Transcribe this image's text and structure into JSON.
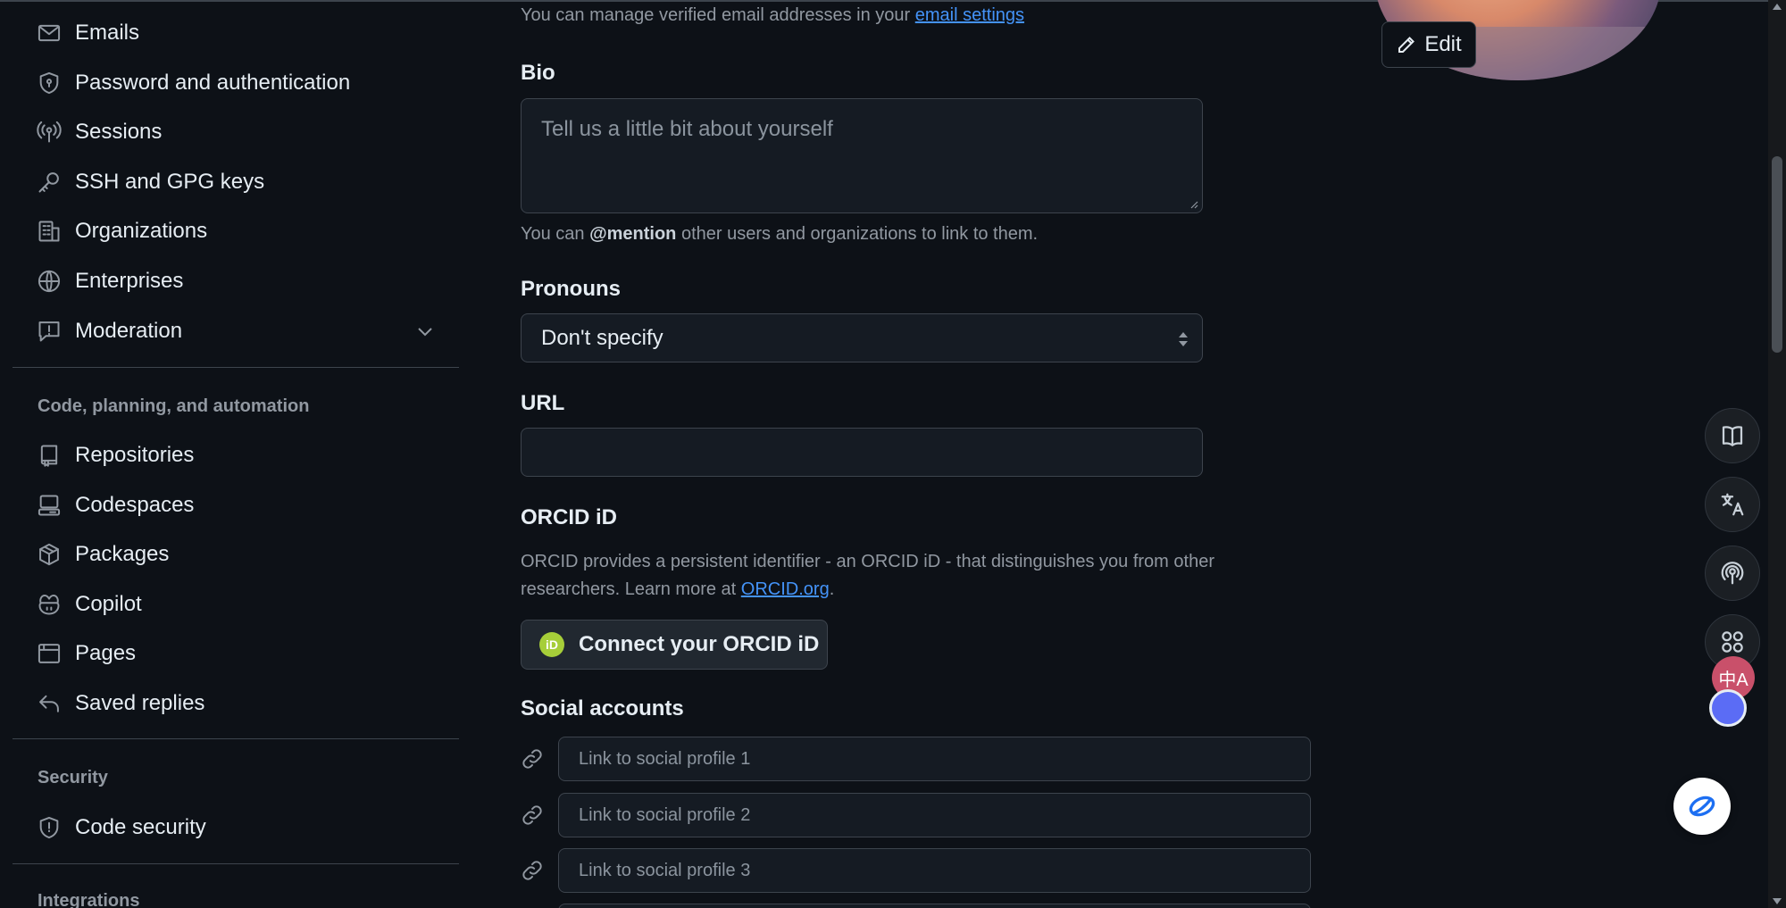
{
  "sidebar": {
    "items_top": [
      {
        "label": "Emails",
        "icon": "mail-icon"
      },
      {
        "label": "Password and authentication",
        "icon": "shield-lock-icon"
      },
      {
        "label": "Sessions",
        "icon": "broadcast-icon"
      },
      {
        "label": "SSH and GPG keys",
        "icon": "key-icon"
      },
      {
        "label": "Organizations",
        "icon": "organization-icon"
      },
      {
        "label": "Enterprises",
        "icon": "globe-icon"
      },
      {
        "label": "Moderation",
        "icon": "report-icon"
      }
    ],
    "section_code": "Code, planning, and automation",
    "items_code": [
      {
        "label": "Repositories",
        "icon": "repo-icon"
      },
      {
        "label": "Codespaces",
        "icon": "codespaces-icon"
      },
      {
        "label": "Packages",
        "icon": "package-icon"
      },
      {
        "label": "Copilot",
        "icon": "copilot-icon"
      },
      {
        "label": "Pages",
        "icon": "browser-icon"
      },
      {
        "label": "Saved replies",
        "icon": "reply-icon"
      }
    ],
    "section_security": "Security",
    "items_security": [
      {
        "label": "Code security",
        "icon": "shield-icon"
      }
    ],
    "section_integrations": "Integrations"
  },
  "main": {
    "email_note_prefix": "You can manage verified email addresses in your",
    "email_note_link": "email settings",
    "bio": {
      "label": "Bio",
      "placeholder": "Tell us a little bit about yourself",
      "help_prefix": "You can",
      "help_mention": "@mention",
      "help_suffix": "other users and organizations to link to them."
    },
    "pronouns": {
      "label": "Pronouns",
      "value": "Don't specify"
    },
    "url": {
      "label": "URL",
      "value": ""
    },
    "orcid": {
      "label": "ORCID iD",
      "desc_line1": "ORCID provides a persistent identifier - an ORCID iD - that distinguishes you from other",
      "desc_line2_prefix": "researchers. Learn more at",
      "desc_link": "ORCID.org",
      "desc_suffix": ".",
      "logo_text": "iD",
      "button": "Connect your ORCID iD"
    },
    "social": {
      "label": "Social accounts",
      "placeholders": [
        "Link to social profile 1",
        "Link to social profile 2",
        "Link to social profile 3"
      ]
    }
  },
  "profile": {
    "edit_label": "Edit"
  },
  "floating_tools": {
    "icons": [
      "book-icon",
      "translate-icon",
      "podcast-icon",
      "apps-icon"
    ],
    "translate_badge": "中A"
  },
  "colors": {
    "background": "#0d1117",
    "text": "#e6edf3",
    "muted": "#9198a1",
    "link": "#4493f8",
    "border": "#3d444d",
    "orcid_green": "#a6ce39"
  }
}
